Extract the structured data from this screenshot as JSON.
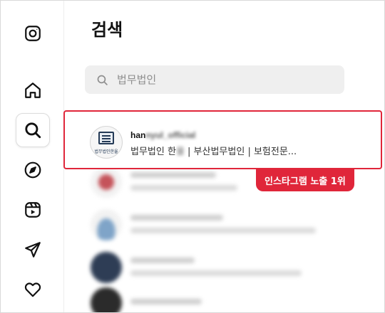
{
  "sidebar": {
    "items": [
      {
        "name": "instagram-logo-icon"
      },
      {
        "name": "home-icon"
      },
      {
        "name": "search-icon",
        "active": true
      },
      {
        "name": "explore-compass-icon"
      },
      {
        "name": "reels-icon"
      },
      {
        "name": "messages-send-icon"
      },
      {
        "name": "notifications-heart-icon"
      }
    ]
  },
  "main": {
    "title": "검색",
    "search": {
      "placeholder": "법무법인",
      "value": ""
    },
    "highlighted_result": {
      "username_visible": "han",
      "username_blurred": "nyul_official",
      "avatar_text": "법무법인한율",
      "description_prefix": "법무법인 한",
      "description_blurred": "율",
      "description_suffix": " | 부산법무법인 | 보험전문..."
    },
    "badge": "인스타그램 노출 1위"
  },
  "colors": {
    "accent_red": "#e0263a",
    "search_bg": "#efefef",
    "text_primary": "#111111",
    "placeholder": "#8e8e8e"
  }
}
